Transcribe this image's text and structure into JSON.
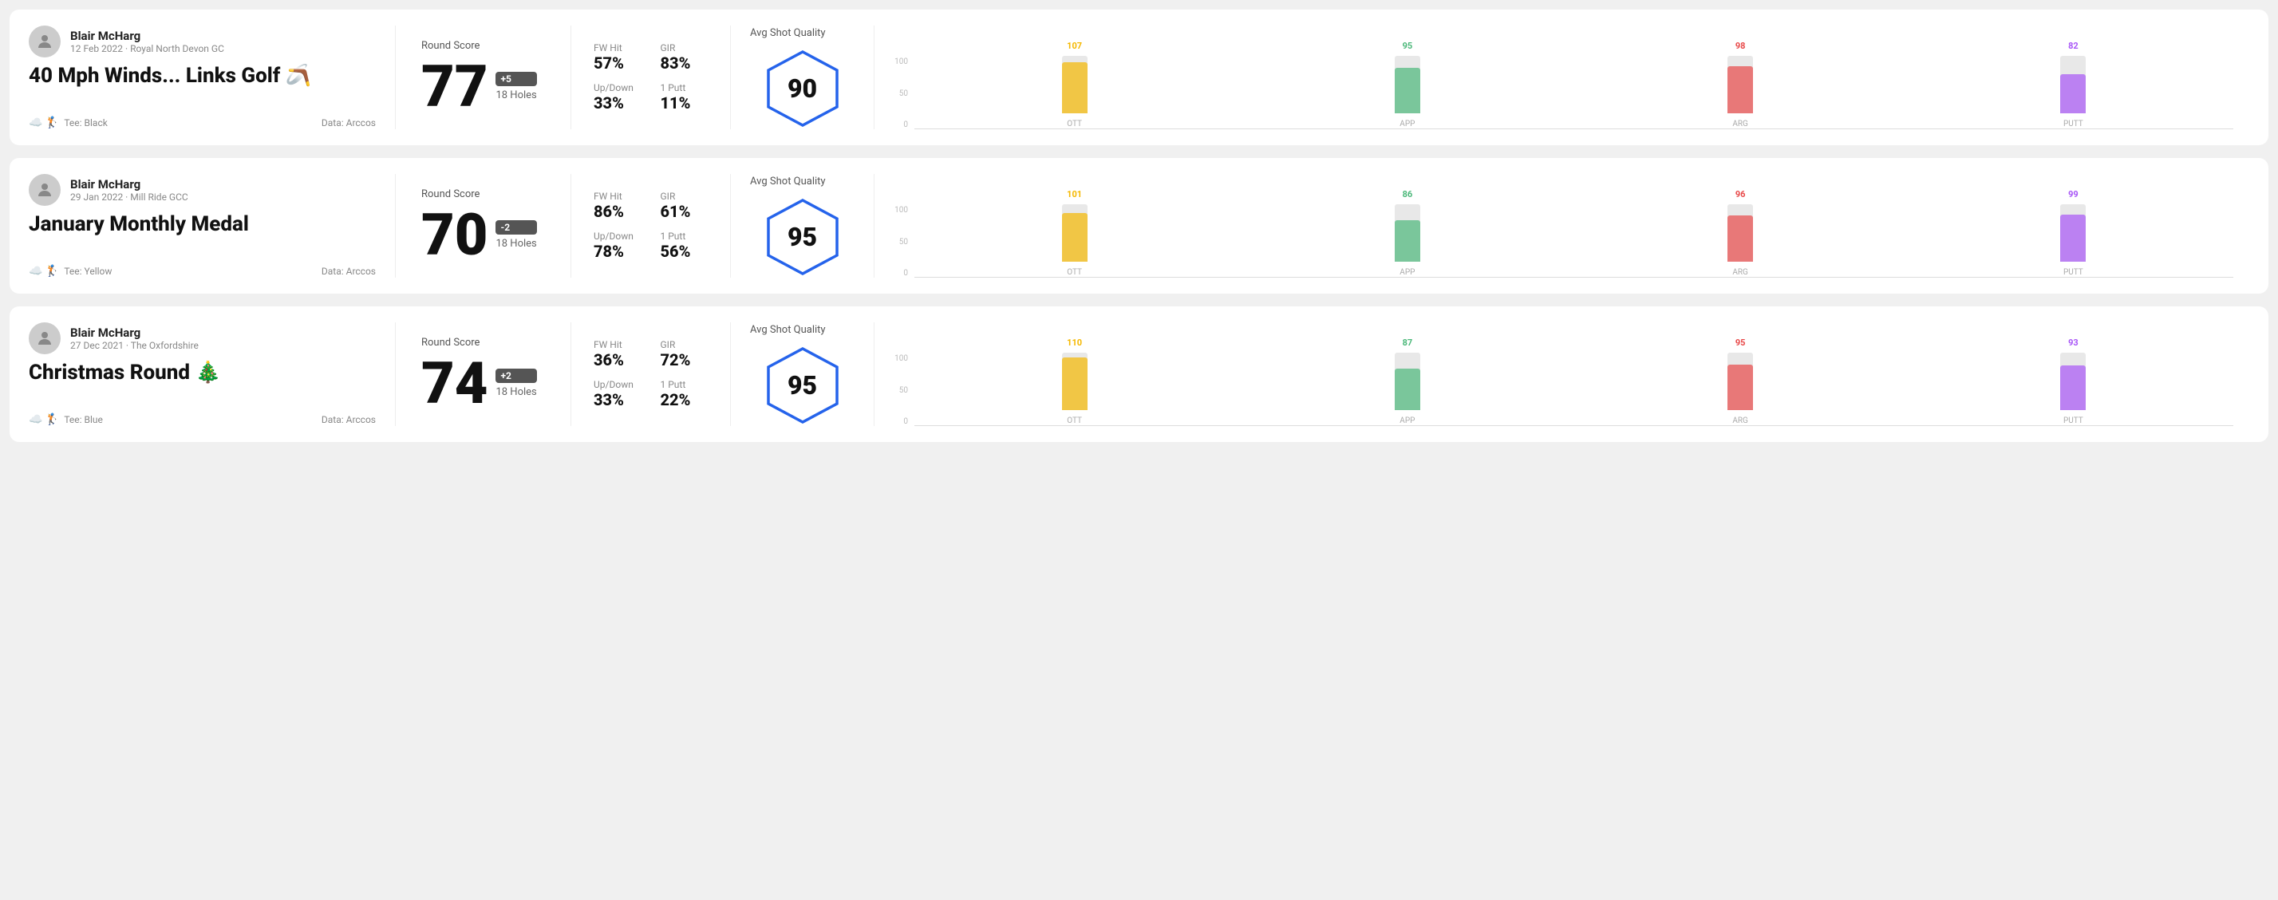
{
  "rounds": [
    {
      "id": "round-1",
      "user": {
        "name": "Blair McHarg",
        "meta": "12 Feb 2022 · Royal North Devon GC"
      },
      "title": "40 Mph Winds... Links Golf 🪃",
      "tee": "Black",
      "data_source": "Data: Arccos",
      "score": "77",
      "score_diff": "+5",
      "holes": "18 Holes",
      "fw_hit": "57%",
      "gir": "83%",
      "up_down": "33%",
      "one_putt": "11%",
      "avg_quality": "90",
      "chart": {
        "ott": {
          "value": 107,
          "color": "#f5b800"
        },
        "app": {
          "value": 95,
          "color": "#4cb87a"
        },
        "arg": {
          "value": 98,
          "color": "#e84848"
        },
        "putt": {
          "value": 82,
          "color": "#a855f7"
        }
      }
    },
    {
      "id": "round-2",
      "user": {
        "name": "Blair McHarg",
        "meta": "29 Jan 2022 · Mill Ride GCC"
      },
      "title": "January Monthly Medal",
      "tee": "Yellow",
      "data_source": "Data: Arccos",
      "score": "70",
      "score_diff": "-2",
      "holes": "18 Holes",
      "fw_hit": "86%",
      "gir": "61%",
      "up_down": "78%",
      "one_putt": "56%",
      "avg_quality": "95",
      "chart": {
        "ott": {
          "value": 101,
          "color": "#f5b800"
        },
        "app": {
          "value": 86,
          "color": "#4cb87a"
        },
        "arg": {
          "value": 96,
          "color": "#e84848"
        },
        "putt": {
          "value": 99,
          "color": "#a855f7"
        }
      }
    },
    {
      "id": "round-3",
      "user": {
        "name": "Blair McHarg",
        "meta": "27 Dec 2021 · The Oxfordshire"
      },
      "title": "Christmas Round 🎄",
      "tee": "Blue",
      "data_source": "Data: Arccos",
      "score": "74",
      "score_diff": "+2",
      "holes": "18 Holes",
      "fw_hit": "36%",
      "gir": "72%",
      "up_down": "33%",
      "one_putt": "22%",
      "avg_quality": "95",
      "chart": {
        "ott": {
          "value": 110,
          "color": "#f5b800"
        },
        "app": {
          "value": 87,
          "color": "#4cb87a"
        },
        "arg": {
          "value": 95,
          "color": "#e84848"
        },
        "putt": {
          "value": 93,
          "color": "#a855f7"
        }
      }
    }
  ],
  "chart_labels": {
    "ott": "OTT",
    "app": "APP",
    "arg": "ARG",
    "putt": "PUTT"
  },
  "chart_y": [
    "100",
    "50",
    "0"
  ],
  "labels": {
    "round_score": "Round Score",
    "fw_hit": "FW Hit",
    "gir": "GIR",
    "up_down": "Up/Down",
    "one_putt": "1 Putt",
    "avg_quality": "Avg Shot Quality",
    "tee_prefix": "Tee: "
  }
}
